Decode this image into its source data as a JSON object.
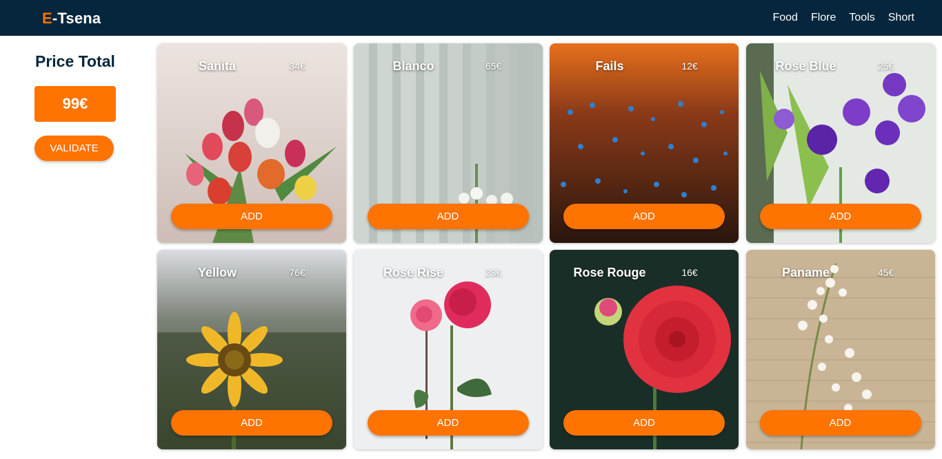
{
  "header": {
    "brand_first": "E",
    "brand_rest": "-Tsena",
    "nav": [
      "Food",
      "Flore",
      "Tools",
      "Short"
    ]
  },
  "sidebar": {
    "title": "Price Total",
    "total": "99€",
    "validate_label": "VALIDATE"
  },
  "products": [
    {
      "name": "Sanita",
      "price": "34€",
      "add_label": "ADD",
      "image": "tulip-bouquet-image"
    },
    {
      "name": "Blanco",
      "price": "65€",
      "add_label": "ADD",
      "image": "white-flowers-panel-image"
    },
    {
      "name": "Fails",
      "price": "12€",
      "add_label": "ADD",
      "image": "blue-wildflowers-image"
    },
    {
      "name": "Rose Blue",
      "price": "25€",
      "add_label": "ADD",
      "image": "purple-lisianthus-image"
    },
    {
      "name": "Yellow",
      "price": "76€",
      "add_label": "ADD",
      "image": "sunflower-image"
    },
    {
      "name": "Rose Rise",
      "price": "23€",
      "add_label": "ADD",
      "image": "pink-rose-image"
    },
    {
      "name": "Rose Rouge",
      "price": "16€",
      "add_label": "ADD",
      "image": "red-dahlia-image"
    },
    {
      "name": "Paname",
      "price": "45€",
      "add_label": "ADD",
      "image": "lily-of-valley-image"
    }
  ],
  "colors": {
    "navbar": "#05263c",
    "accent": "#ff7300",
    "text_dark": "#05263c"
  }
}
